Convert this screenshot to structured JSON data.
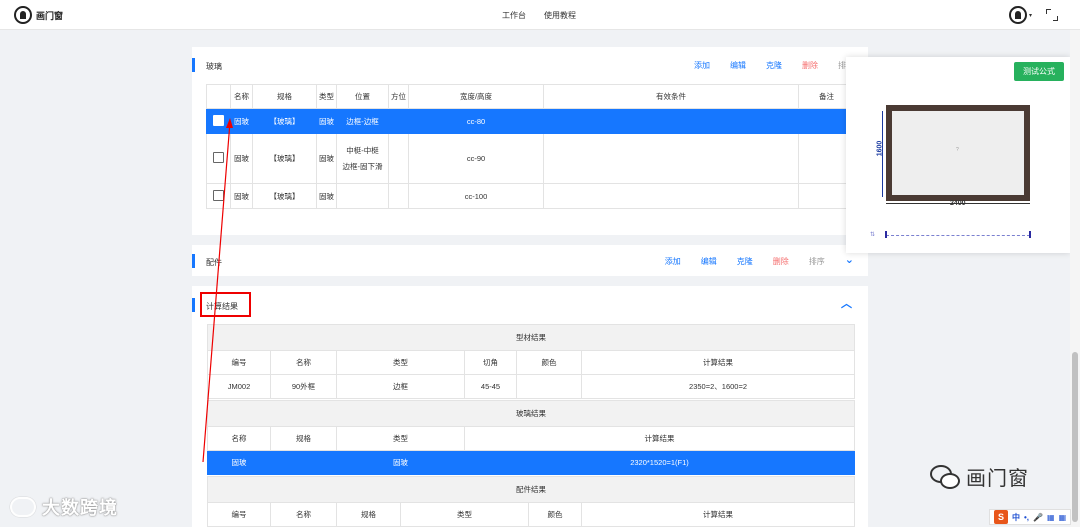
{
  "header": {
    "logo_text": "画门窗",
    "nav": [
      "工作台",
      "使用教程"
    ],
    "user_caret": "▾"
  },
  "glass_panel": {
    "title": "玻璃",
    "actions": [
      "添加",
      "编辑",
      "克隆",
      "删除",
      "排序"
    ],
    "columns": [
      "名称",
      "规格",
      "类型",
      "位置",
      "方位",
      "宽度/高度",
      "有效条件",
      "备注"
    ],
    "rows": [
      {
        "name": "固玻",
        "spec": "【玻璃】",
        "type": "固玻",
        "position": "边框-边框",
        "orient": "",
        "size": "cc-80",
        "condition": "",
        "note": ""
      },
      {
        "name": "固玻",
        "spec": "【玻璃】",
        "type": "固玻",
        "position_line1": "中梃-中梃",
        "position_line2": "边框-固下滑",
        "orient": "",
        "size": "cc-90",
        "condition": "",
        "note": ""
      },
      {
        "name": "固玻",
        "spec": "【玻璃】",
        "type": "固玻",
        "position": "",
        "orient": "",
        "size": "cc-100",
        "condition": "",
        "note": ""
      }
    ]
  },
  "parts_panel": {
    "title": "配件",
    "actions": [
      "添加",
      "编辑",
      "克隆",
      "删除",
      "排序"
    ],
    "chevron": "⌄"
  },
  "result_panel": {
    "title": "计算结果",
    "chevron": "︿",
    "profile": {
      "group": "型材结果",
      "headers": [
        "编号",
        "名称",
        "类型",
        "切角",
        "颜色",
        "计算结果"
      ],
      "rows": [
        [
          "JM002",
          "90外框",
          "边框",
          "45-45",
          "",
          "2350=2、1600=2"
        ]
      ]
    },
    "glass": {
      "group": "玻璃结果",
      "headers": [
        "名称",
        "规格",
        "类型",
        "计算结果"
      ],
      "rows": [
        [
          "固玻",
          "",
          "固玻",
          "2320*1520=1(F1)"
        ]
      ]
    },
    "parts": {
      "group": "配件结果",
      "headers": [
        "编号",
        "名称",
        "规格",
        "类型",
        "颜色",
        "计算结果"
      ]
    }
  },
  "preview": {
    "test_button": "测试公式",
    "height_label": "1600",
    "width_label": "2400",
    "center_mark": "?",
    "slider_icon": "⇅"
  },
  "watermarks": {
    "left": "大数跨境",
    "right": "画门窗"
  },
  "ime": {
    "logo": "S",
    "items": [
      "中",
      "•,",
      "🎤",
      "▦",
      "▦"
    ]
  },
  "colors": {
    "accent": "#1677ff",
    "danger": "#f56c6c",
    "test_button": "#27b15d",
    "highlight": "#ee0000",
    "window_frame": "#4a3a33"
  }
}
